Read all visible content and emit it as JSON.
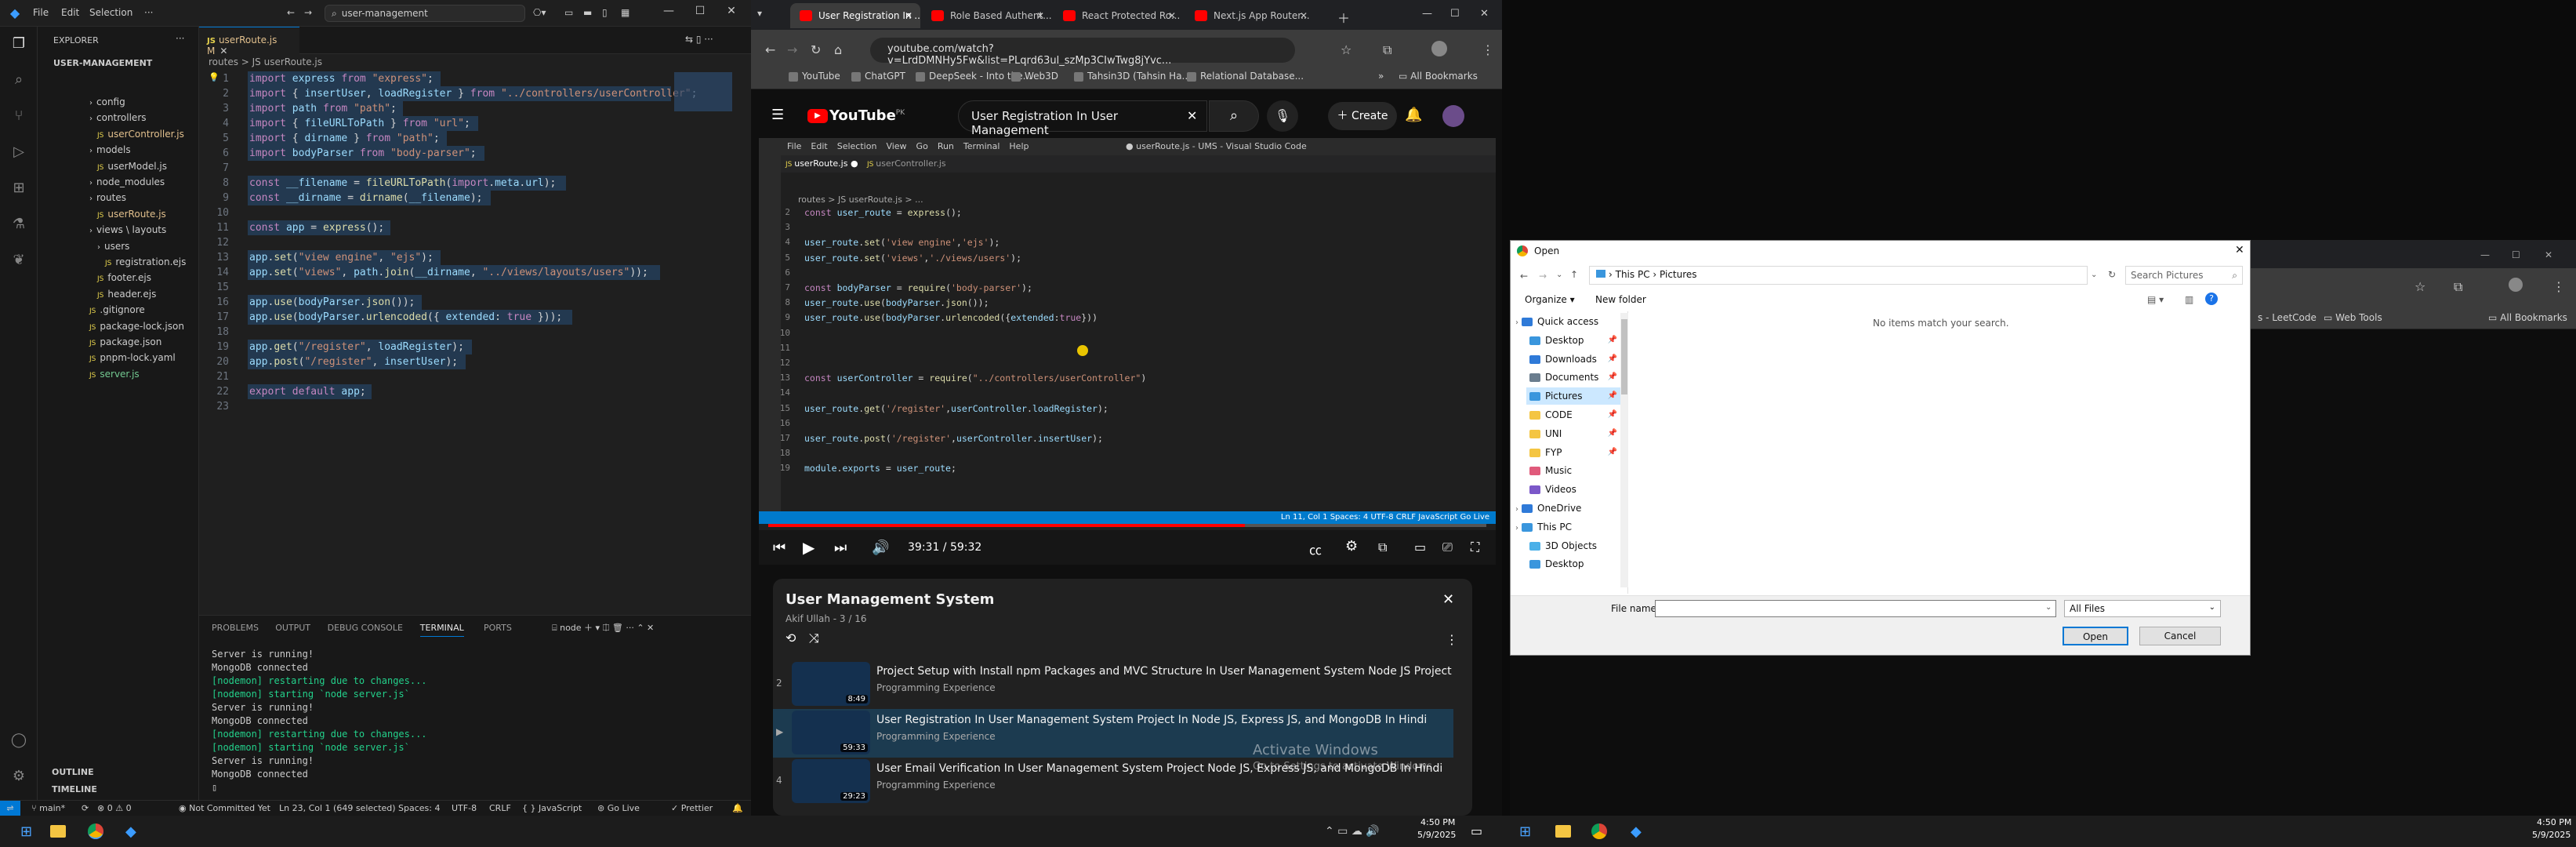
{
  "vscode": {
    "menu": [
      "File",
      "Edit",
      "Selection"
    ],
    "more": "···",
    "command_center": "user-management",
    "explorer_title": "EXPLORER",
    "project": "USER-MANAGEMENT",
    "tree": [
      {
        "label": "config",
        "indent": 1,
        "type": "folder"
      },
      {
        "label": "controllers",
        "indent": 1,
        "type": "folder"
      },
      {
        "label": "userController.js",
        "indent": 2,
        "type": "file",
        "git": "M"
      },
      {
        "label": "models",
        "indent": 1,
        "type": "folder"
      },
      {
        "label": "userModel.js",
        "indent": 2,
        "type": "file"
      },
      {
        "label": "node_modules",
        "indent": 1,
        "type": "folder"
      },
      {
        "label": "routes",
        "indent": 1,
        "type": "folder"
      },
      {
        "label": "userRoute.js",
        "indent": 2,
        "type": "file",
        "git": "M"
      },
      {
        "label": "views \\ layouts",
        "indent": 1,
        "type": "folder"
      },
      {
        "label": "users",
        "indent": 2,
        "type": "folder"
      },
      {
        "label": "registration.ejs",
        "indent": 3,
        "type": "file"
      },
      {
        "label": "footer.ejs",
        "indent": 2,
        "type": "file"
      },
      {
        "label": "header.ejs",
        "indent": 2,
        "type": "file"
      },
      {
        "label": ".gitignore",
        "indent": 1,
        "type": "file"
      },
      {
        "label": "package-lock.json",
        "indent": 1,
        "type": "file"
      },
      {
        "label": "package.json",
        "indent": 1,
        "type": "file"
      },
      {
        "label": "pnpm-lock.yaml",
        "indent": 1,
        "type": "file"
      },
      {
        "label": "server.js",
        "indent": 1,
        "type": "file",
        "git": "U"
      }
    ],
    "outline": "OUTLINE",
    "timeline": "TIMELINE",
    "tab": "userRoute.js M",
    "breadcrumb": "routes > JS userRoute.js",
    "code": [
      "import express from \"express\";",
      "import { insertUser, loadRegister } from \"../controllers/userController\";",
      "import path from \"path\";",
      "import { fileURLToPath } from \"url\";",
      "import { dirname } from \"path\";",
      "import bodyParser from \"body-parser\";",
      "",
      "const __filename = fileURLToPath(import.meta.url);",
      "const __dirname = dirname(__filename);",
      "",
      "const app = express();",
      "",
      "app.set(\"view engine\", \"ejs\");",
      "app.set(\"views\", path.join(__dirname, \"../views/layouts/users\"));",
      "",
      "app.use(bodyParser.json());",
      "app.use(bodyParser.urlencoded({ extended: true }));",
      "",
      "app.get(\"/register\", loadRegister);",
      "app.post(\"/register\", insertUser);",
      "",
      "export default app;",
      ""
    ],
    "panel_tabs": [
      "PROBLEMS",
      "OUTPUT",
      "DEBUG CONSOLE",
      "TERMINAL",
      "PORTS"
    ],
    "terminal_name": "node",
    "terminal": [
      {
        "t": "Server is running!",
        "c": "#cccccc"
      },
      {
        "t": "MongoDB connected",
        "c": "#cccccc"
      },
      {
        "t": "[nodemon] restarting due to changes...",
        "c": "#23d18b"
      },
      {
        "t": "[nodemon] starting `node server.js`",
        "c": "#23d18b"
      },
      {
        "t": "Server is running!",
        "c": "#cccccc"
      },
      {
        "t": "MongoDB connected",
        "c": "#cccccc"
      },
      {
        "t": "[nodemon] restarting due to changes...",
        "c": "#23d18b"
      },
      {
        "t": "[nodemon] starting `node server.js`",
        "c": "#23d18b"
      },
      {
        "t": "Server is running!",
        "c": "#cccccc"
      },
      {
        "t": "MongoDB connected",
        "c": "#cccccc"
      }
    ],
    "status": {
      "branch": "main*",
      "sync": "⟳",
      "errors": "⊗ 0 ⚠ 0",
      "commit": "Not Committed Yet",
      "cursor": "Ln 23, Col 1 (649 selected)",
      "spaces": "Spaces: 4",
      "encoding": "UTF-8",
      "eol": "CRLF",
      "lang": "{ } JavaScript",
      "golive": "Go Live",
      "prettier": "✓ Prettier"
    }
  },
  "chrome": {
    "tabs": [
      "User Registration In ...",
      "Role Based Authent...",
      "React Protected Ro...",
      "Next.js App Router..."
    ],
    "url": "youtube.com/watch?v=LrdDMNHy5Fw&list=PLqrd63ul_szMp3CIwTwg8jYvc...",
    "bookmarks": [
      "YouTube",
      "ChatGPT",
      "DeepSeek - Into the...",
      "Web3D",
      "Tahsin3D (Tahsin Ha...",
      "Relational Database..."
    ],
    "all_bookmarks": "All Bookmarks",
    "yt_logo": "YouTube",
    "yt_region": "PK",
    "search": "User Registration In User Management",
    "create": "Create",
    "video": {
      "window_title": "● userRoute.js - UMS - Visual Studio Code",
      "menu": [
        "File",
        "Edit",
        "Selection",
        "View",
        "Go",
        "Run",
        "Terminal",
        "Help"
      ],
      "tab1": "userRoute.js",
      "tab2": "userController.js",
      "crumb": "routes > JS userRoute.js > ...",
      "first_ln": 2,
      "code": [
        "const user_route = express();",
        "",
        "user_route.set('view engine','ejs');",
        "user_route.set('views','./views/users');",
        "",
        "const bodyParser = require('body-parser');",
        "user_route.use(bodyParser.json());",
        "user_route.use(bodyParser.urlencoded({extended:true}))",
        "",
        "",
        "",
        "const userController = require(\"../controllers/userController\")",
        "",
        "user_route.get('/register',userController.loadRegister);",
        "",
        "user_route.post('/register',userController.insertUser);",
        "",
        "module.exports = user_route;"
      ],
      "statusbar": "Ln 11, Col 1   Spaces: 4   UTF-8   CRLF   JavaScript   Go Live",
      "time": "39:31 / 59:32",
      "progress": 0.664
    },
    "playlist": {
      "title": "User Management System",
      "meta": "Akif Ullah - 3 / 16",
      "items": [
        {
          "num": "2",
          "title": "Project Setup with Install npm Packages and MVC Structure In User Management System Node JS Project",
          "channel": "Programming Experience",
          "duration": "8:49"
        },
        {
          "num": "▶",
          "title": "User Registration In User Management System Project In Node JS, Express JS, and MongoDB In Hindi",
          "channel": "Programming Experience",
          "duration": "59:33"
        },
        {
          "num": "4",
          "title": "User Email Verification In User Management System Project Node JS, Express JS, and MongoDB In Hindi",
          "channel": "Programming Experience",
          "duration": "29:23"
        }
      ],
      "activate1": "Activate Windows",
      "activate2": "Go to Settings to activate Windows."
    }
  },
  "dialog": {
    "title": "Open",
    "path": [
      "This PC",
      "Pictures"
    ],
    "search_placeholder": "Search Pictures",
    "organize": "Organize ▾",
    "new_folder": "New folder",
    "empty": "No items match your search.",
    "nav": [
      {
        "label": "Quick access",
        "indent": 0,
        "color": "#2f7ad8"
      },
      {
        "label": "Desktop",
        "indent": 1,
        "color": "#3a96dd",
        "pin": true
      },
      {
        "label": "Downloads",
        "indent": 1,
        "color": "#2f7ad8",
        "pin": true
      },
      {
        "label": "Documents",
        "indent": 1,
        "color": "#6a7d8e",
        "pin": true
      },
      {
        "label": "Pictures",
        "indent": 1,
        "color": "#3a96dd",
        "pin": true,
        "selected": true
      },
      {
        "label": "CODE",
        "indent": 1,
        "color": "#f4c542",
        "pin": true
      },
      {
        "label": "UNI",
        "indent": 1,
        "color": "#f4c542",
        "pin": true
      },
      {
        "label": "FYP",
        "indent": 1,
        "color": "#f4c542",
        "pin": true
      },
      {
        "label": "Music",
        "indent": 1,
        "color": "#e05a7b"
      },
      {
        "label": "Videos",
        "indent": 1,
        "color": "#7b58c9"
      },
      {
        "label": "OneDrive",
        "indent": 0,
        "color": "#2f7ad8"
      },
      {
        "label": "This PC",
        "indent": 0,
        "color": "#3a96dd"
      },
      {
        "label": "3D Objects",
        "indent": 1,
        "color": "#4ab0e8"
      },
      {
        "label": "Desktop",
        "indent": 1,
        "color": "#3a96dd"
      }
    ],
    "file_name_label": "File name:",
    "file_type": "All Files",
    "open": "Open",
    "cancel": "Cancel"
  },
  "right_chrome": {
    "bookmarks": [
      "s - LeetCode",
      "Web Tools"
    ],
    "all_bookmarks": "All Bookmarks"
  },
  "taskbar": {
    "time_left": "4:50 PM",
    "date_left": "5/9/2025",
    "time_right": "4:50 PM",
    "date_right": "5/9/2025"
  }
}
